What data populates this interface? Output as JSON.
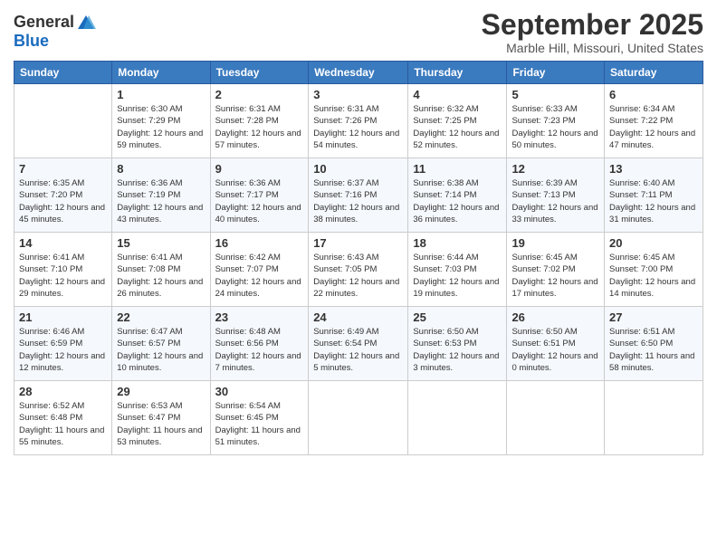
{
  "header": {
    "logo_general": "General",
    "logo_blue": "Blue",
    "month": "September 2025",
    "location": "Marble Hill, Missouri, United States"
  },
  "weekdays": [
    "Sunday",
    "Monday",
    "Tuesday",
    "Wednesday",
    "Thursday",
    "Friday",
    "Saturday"
  ],
  "weeks": [
    [
      {
        "day": "",
        "sunrise": "",
        "sunset": "",
        "daylight": ""
      },
      {
        "day": "1",
        "sunrise": "Sunrise: 6:30 AM",
        "sunset": "Sunset: 7:29 PM",
        "daylight": "Daylight: 12 hours and 59 minutes."
      },
      {
        "day": "2",
        "sunrise": "Sunrise: 6:31 AM",
        "sunset": "Sunset: 7:28 PM",
        "daylight": "Daylight: 12 hours and 57 minutes."
      },
      {
        "day": "3",
        "sunrise": "Sunrise: 6:31 AM",
        "sunset": "Sunset: 7:26 PM",
        "daylight": "Daylight: 12 hours and 54 minutes."
      },
      {
        "day": "4",
        "sunrise": "Sunrise: 6:32 AM",
        "sunset": "Sunset: 7:25 PM",
        "daylight": "Daylight: 12 hours and 52 minutes."
      },
      {
        "day": "5",
        "sunrise": "Sunrise: 6:33 AM",
        "sunset": "Sunset: 7:23 PM",
        "daylight": "Daylight: 12 hours and 50 minutes."
      },
      {
        "day": "6",
        "sunrise": "Sunrise: 6:34 AM",
        "sunset": "Sunset: 7:22 PM",
        "daylight": "Daylight: 12 hours and 47 minutes."
      }
    ],
    [
      {
        "day": "7",
        "sunrise": "Sunrise: 6:35 AM",
        "sunset": "Sunset: 7:20 PM",
        "daylight": "Daylight: 12 hours and 45 minutes."
      },
      {
        "day": "8",
        "sunrise": "Sunrise: 6:36 AM",
        "sunset": "Sunset: 7:19 PM",
        "daylight": "Daylight: 12 hours and 43 minutes."
      },
      {
        "day": "9",
        "sunrise": "Sunrise: 6:36 AM",
        "sunset": "Sunset: 7:17 PM",
        "daylight": "Daylight: 12 hours and 40 minutes."
      },
      {
        "day": "10",
        "sunrise": "Sunrise: 6:37 AM",
        "sunset": "Sunset: 7:16 PM",
        "daylight": "Daylight: 12 hours and 38 minutes."
      },
      {
        "day": "11",
        "sunrise": "Sunrise: 6:38 AM",
        "sunset": "Sunset: 7:14 PM",
        "daylight": "Daylight: 12 hours and 36 minutes."
      },
      {
        "day": "12",
        "sunrise": "Sunrise: 6:39 AM",
        "sunset": "Sunset: 7:13 PM",
        "daylight": "Daylight: 12 hours and 33 minutes."
      },
      {
        "day": "13",
        "sunrise": "Sunrise: 6:40 AM",
        "sunset": "Sunset: 7:11 PM",
        "daylight": "Daylight: 12 hours and 31 minutes."
      }
    ],
    [
      {
        "day": "14",
        "sunrise": "Sunrise: 6:41 AM",
        "sunset": "Sunset: 7:10 PM",
        "daylight": "Daylight: 12 hours and 29 minutes."
      },
      {
        "day": "15",
        "sunrise": "Sunrise: 6:41 AM",
        "sunset": "Sunset: 7:08 PM",
        "daylight": "Daylight: 12 hours and 26 minutes."
      },
      {
        "day": "16",
        "sunrise": "Sunrise: 6:42 AM",
        "sunset": "Sunset: 7:07 PM",
        "daylight": "Daylight: 12 hours and 24 minutes."
      },
      {
        "day": "17",
        "sunrise": "Sunrise: 6:43 AM",
        "sunset": "Sunset: 7:05 PM",
        "daylight": "Daylight: 12 hours and 22 minutes."
      },
      {
        "day": "18",
        "sunrise": "Sunrise: 6:44 AM",
        "sunset": "Sunset: 7:03 PM",
        "daylight": "Daylight: 12 hours and 19 minutes."
      },
      {
        "day": "19",
        "sunrise": "Sunrise: 6:45 AM",
        "sunset": "Sunset: 7:02 PM",
        "daylight": "Daylight: 12 hours and 17 minutes."
      },
      {
        "day": "20",
        "sunrise": "Sunrise: 6:45 AM",
        "sunset": "Sunset: 7:00 PM",
        "daylight": "Daylight: 12 hours and 14 minutes."
      }
    ],
    [
      {
        "day": "21",
        "sunrise": "Sunrise: 6:46 AM",
        "sunset": "Sunset: 6:59 PM",
        "daylight": "Daylight: 12 hours and 12 minutes."
      },
      {
        "day": "22",
        "sunrise": "Sunrise: 6:47 AM",
        "sunset": "Sunset: 6:57 PM",
        "daylight": "Daylight: 12 hours and 10 minutes."
      },
      {
        "day": "23",
        "sunrise": "Sunrise: 6:48 AM",
        "sunset": "Sunset: 6:56 PM",
        "daylight": "Daylight: 12 hours and 7 minutes."
      },
      {
        "day": "24",
        "sunrise": "Sunrise: 6:49 AM",
        "sunset": "Sunset: 6:54 PM",
        "daylight": "Daylight: 12 hours and 5 minutes."
      },
      {
        "day": "25",
        "sunrise": "Sunrise: 6:50 AM",
        "sunset": "Sunset: 6:53 PM",
        "daylight": "Daylight: 12 hours and 3 minutes."
      },
      {
        "day": "26",
        "sunrise": "Sunrise: 6:50 AM",
        "sunset": "Sunset: 6:51 PM",
        "daylight": "Daylight: 12 hours and 0 minutes."
      },
      {
        "day": "27",
        "sunrise": "Sunrise: 6:51 AM",
        "sunset": "Sunset: 6:50 PM",
        "daylight": "Daylight: 11 hours and 58 minutes."
      }
    ],
    [
      {
        "day": "28",
        "sunrise": "Sunrise: 6:52 AM",
        "sunset": "Sunset: 6:48 PM",
        "daylight": "Daylight: 11 hours and 55 minutes."
      },
      {
        "day": "29",
        "sunrise": "Sunrise: 6:53 AM",
        "sunset": "Sunset: 6:47 PM",
        "daylight": "Daylight: 11 hours and 53 minutes."
      },
      {
        "day": "30",
        "sunrise": "Sunrise: 6:54 AM",
        "sunset": "Sunset: 6:45 PM",
        "daylight": "Daylight: 11 hours and 51 minutes."
      },
      {
        "day": "",
        "sunrise": "",
        "sunset": "",
        "daylight": ""
      },
      {
        "day": "",
        "sunrise": "",
        "sunset": "",
        "daylight": ""
      },
      {
        "day": "",
        "sunrise": "",
        "sunset": "",
        "daylight": ""
      },
      {
        "day": "",
        "sunrise": "",
        "sunset": "",
        "daylight": ""
      }
    ]
  ]
}
